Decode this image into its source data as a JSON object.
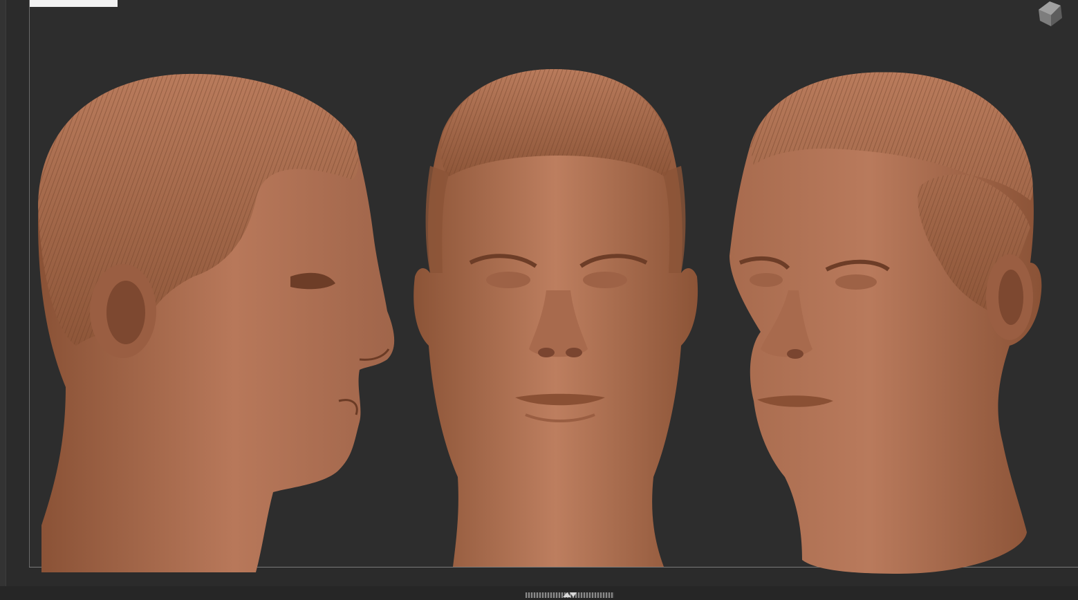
{
  "viewport": {
    "background_color": "#2d2d2d",
    "material_color": "#b0724f"
  },
  "model": {
    "views": [
      "side-profile-right",
      "front",
      "three-quarter-left"
    ]
  },
  "icons": {
    "view_cube": "navigation-cube-icon",
    "tray": "tray-toggle-arrows-icon"
  }
}
